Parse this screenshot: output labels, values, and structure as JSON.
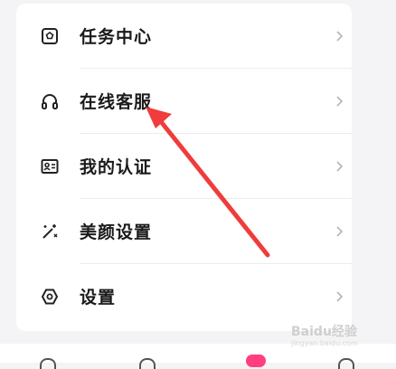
{
  "menu": {
    "items": [
      {
        "label": "任务中心",
        "icon": "task-icon"
      },
      {
        "label": "在线客服",
        "icon": "headphones-icon"
      },
      {
        "label": "我的认证",
        "icon": "id-card-icon"
      },
      {
        "label": "美颜设置",
        "icon": "magic-wand-icon"
      },
      {
        "label": "设置",
        "icon": "gear-icon"
      }
    ]
  },
  "annotation": {
    "arrow_color": "#f03c3c"
  },
  "watermark": {
    "text": "Baidu经验",
    "sub": "jingyan.baidu.com"
  }
}
